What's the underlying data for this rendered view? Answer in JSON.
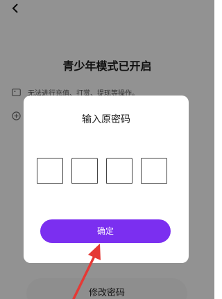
{
  "header": {
    "back_icon": "back-arrow-icon"
  },
  "page": {
    "title": "青少年模式已开启",
    "info_rows": [
      {
        "icon": "wallet-icon",
        "text": "无法进行充值、打赏、提现等操作。"
      },
      {
        "icon": "plus-circle-icon",
        "text": ""
      }
    ],
    "bottom_button_label": "修改密码"
  },
  "dialog": {
    "title": "输入原密码",
    "code_box_count": 4,
    "confirm_label": "确定",
    "accent_color": "#7b2ff0"
  },
  "annotation": {
    "arrow_color": "#e53935"
  }
}
